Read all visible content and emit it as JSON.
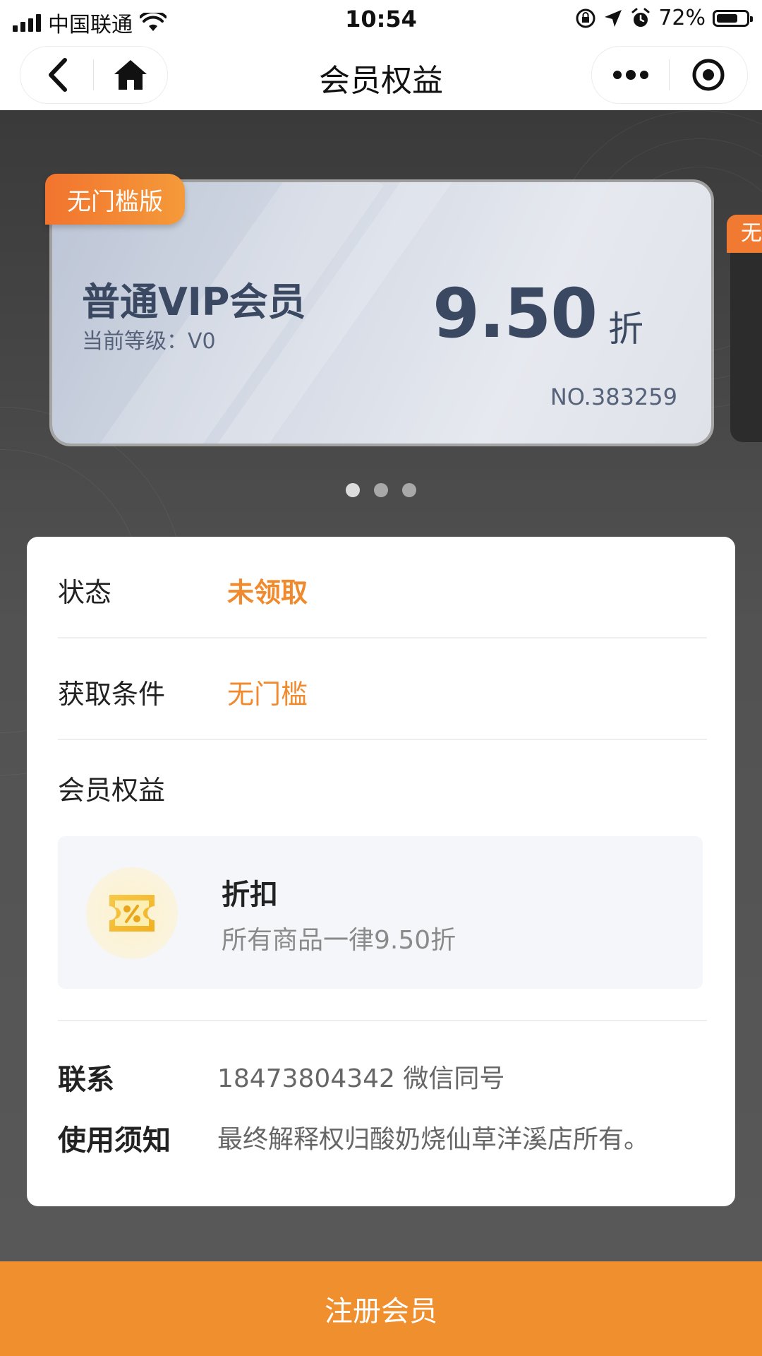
{
  "status_bar": {
    "carrier": "中国联通",
    "time": "10:54",
    "battery_percent": "72%",
    "battery_level": 0.72,
    "icons": [
      "signal-icon",
      "wifi-icon",
      "orientation-lock-icon",
      "location-icon",
      "alarm-icon",
      "battery-icon"
    ]
  },
  "nav": {
    "title": "会员权益",
    "icons": [
      "back-icon",
      "home-icon",
      "more-icon",
      "capsule-close-icon"
    ]
  },
  "card": {
    "tag": "无门槛版",
    "title": "普通VIP会员",
    "level": "当前等级：V0",
    "discount": "9.50",
    "discount_unit": "折",
    "number": "NO.383259",
    "next_card_tag": "无",
    "pagination": {
      "count": 3,
      "active": 1
    }
  },
  "details": {
    "status_label": "状态",
    "status_value": "未领取",
    "condition_label": "获取条件",
    "condition_value": "无门槛",
    "benefits_label": "会员权益",
    "benefit": {
      "icon": "discount-ticket-icon",
      "name": "折扣",
      "description": "所有商品一律9.50折"
    },
    "contact_label": "联系",
    "contact_value": "18473804342 微信同号",
    "notice_label": "使用须知",
    "notice_value": "最终解释权归酸奶烧仙草洋溪店所有。"
  },
  "footer": {
    "register_button": "注册会员"
  },
  "colors": {
    "accent": "#f08f2e",
    "card_text": "#3b4862",
    "background": "#4a4a4a"
  }
}
